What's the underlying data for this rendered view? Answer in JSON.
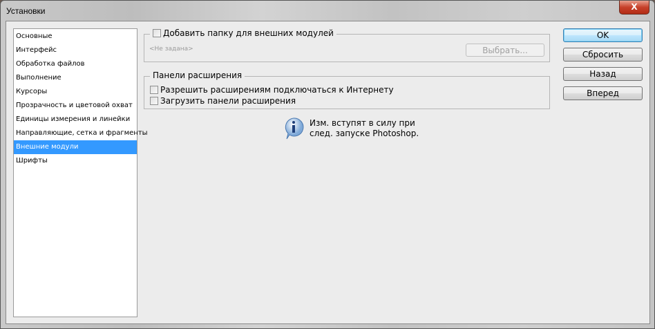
{
  "window": {
    "title": "Установки",
    "close_label": "X"
  },
  "sidebar": {
    "items": [
      {
        "label": "Основные"
      },
      {
        "label": "Интерфейс"
      },
      {
        "label": "Обработка файлов"
      },
      {
        "label": "Выполнение"
      },
      {
        "label": "Курсоры"
      },
      {
        "label": "Прозрачность и цветовой охват"
      },
      {
        "label": "Единицы измерения и линейки"
      },
      {
        "label": "Направляющие, сетка и фрагменты"
      },
      {
        "label": "Внешние модули",
        "selected": true
      },
      {
        "label": "Шрифты"
      }
    ]
  },
  "plugins": {
    "add_folder_label": "Добавить папку для внешних модулей",
    "add_folder_checked": false,
    "folder_value": "<Не задана>",
    "choose_label": "Выбрать..."
  },
  "extensions": {
    "title": "Панели расширения",
    "allow_internet_label": "Разрешить расширениям подключаться к Интернету",
    "allow_internet_checked": false,
    "load_panels_label": "Загрузить панели расширения",
    "load_panels_checked": false
  },
  "info": {
    "line1": "Изм. вступят в силу при",
    "line2": "след. запуске Photoshop."
  },
  "buttons": {
    "ok": "OK",
    "reset": "Сбросить",
    "back": "Назад",
    "forward": "Вперед"
  }
}
